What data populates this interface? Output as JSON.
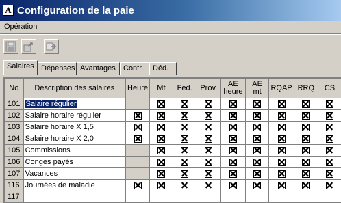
{
  "window": {
    "title": "Configuration de la paie",
    "app_icon": "A"
  },
  "menu": {
    "items": [
      "Opération"
    ]
  },
  "toolbar": {
    "buttons": [
      "save-icon",
      "export-icon",
      "forward-icon"
    ]
  },
  "tabs": [
    "Salaires",
    "Dépenses",
    "Avantages",
    "Contr.",
    "Déd."
  ],
  "active_tab": "Salaires",
  "grid": {
    "columns": [
      "No",
      "Description des salaires",
      "Heure",
      "Mt",
      "Féd.",
      "Prov.",
      "AE heure",
      "AE mt",
      "RQAP",
      "RRQ",
      "CS"
    ],
    "rows": [
      {
        "no": "101",
        "desc": "Salaire régulier",
        "heure": false,
        "mt": true,
        "fed": true,
        "prov": true,
        "ae_heure": true,
        "ae_mt": true,
        "rqap": true,
        "rrq": true,
        "cs": true
      },
      {
        "no": "102",
        "desc": "Salaire horaire régulier",
        "heure": true,
        "mt": true,
        "fed": true,
        "prov": true,
        "ae_heure": true,
        "ae_mt": true,
        "rqap": true,
        "rrq": true,
        "cs": true
      },
      {
        "no": "103",
        "desc": "Salaire horaire X 1,5",
        "heure": true,
        "mt": true,
        "fed": true,
        "prov": true,
        "ae_heure": true,
        "ae_mt": true,
        "rqap": true,
        "rrq": true,
        "cs": true
      },
      {
        "no": "104",
        "desc": "Salaire horaire X 2,0",
        "heure": true,
        "mt": true,
        "fed": true,
        "prov": true,
        "ae_heure": true,
        "ae_mt": true,
        "rqap": true,
        "rrq": true,
        "cs": true
      },
      {
        "no": "105",
        "desc": "Commissions",
        "heure": false,
        "mt": true,
        "fed": true,
        "prov": true,
        "ae_heure": true,
        "ae_mt": true,
        "rqap": true,
        "rrq": true,
        "cs": true
      },
      {
        "no": "106",
        "desc": "Congés payés",
        "heure": false,
        "mt": true,
        "fed": true,
        "prov": true,
        "ae_heure": true,
        "ae_mt": true,
        "rqap": true,
        "rrq": true,
        "cs": true
      },
      {
        "no": "107",
        "desc": "Vacances",
        "heure": false,
        "mt": true,
        "fed": true,
        "prov": true,
        "ae_heure": true,
        "ae_mt": true,
        "rqap": true,
        "rrq": true,
        "cs": true
      },
      {
        "no": "116",
        "desc": "Journées de maladie",
        "heure": true,
        "mt": true,
        "fed": true,
        "prov": true,
        "ae_heure": true,
        "ae_mt": true,
        "rqap": true,
        "rrq": true,
        "cs": true
      },
      {
        "no": "117",
        "desc": "",
        "heure": false,
        "mt": false,
        "fed": false,
        "prov": false,
        "ae_heure": false,
        "ae_mt": false,
        "rqap": false,
        "rrq": false,
        "cs": false
      }
    ],
    "selected_row": 0
  },
  "colors": {
    "titlebar": "#0a246a",
    "selection": "#0a246a",
    "face": "#d4d0c8"
  }
}
